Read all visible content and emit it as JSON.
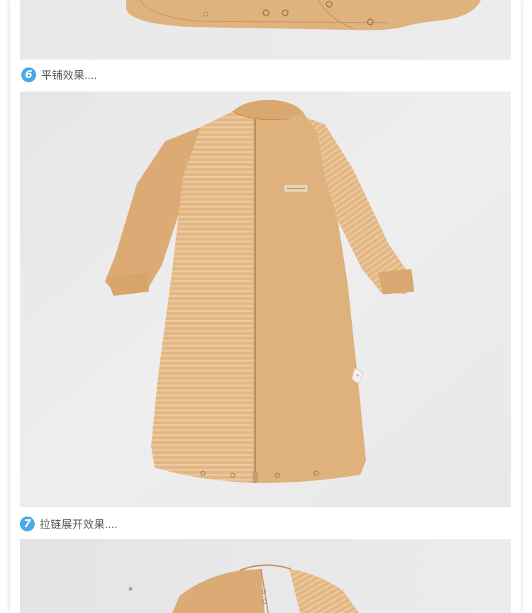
{
  "captions": [
    {
      "number": "6",
      "text": "平铺效果...."
    },
    {
      "number": "7",
      "text": "拉链展开效果...."
    }
  ],
  "colors": {
    "badge": "#4aa8e8",
    "caption_text": "#555555",
    "garment": "#dfb17c",
    "background_photo": "#ebebeb"
  },
  "photos": [
    {
      "subject": "garment-close-up-snaps"
    },
    {
      "subject": "baby-sleep-gown-flat-lay"
    },
    {
      "subject": "baby-sleep-gown-zip-open"
    }
  ]
}
